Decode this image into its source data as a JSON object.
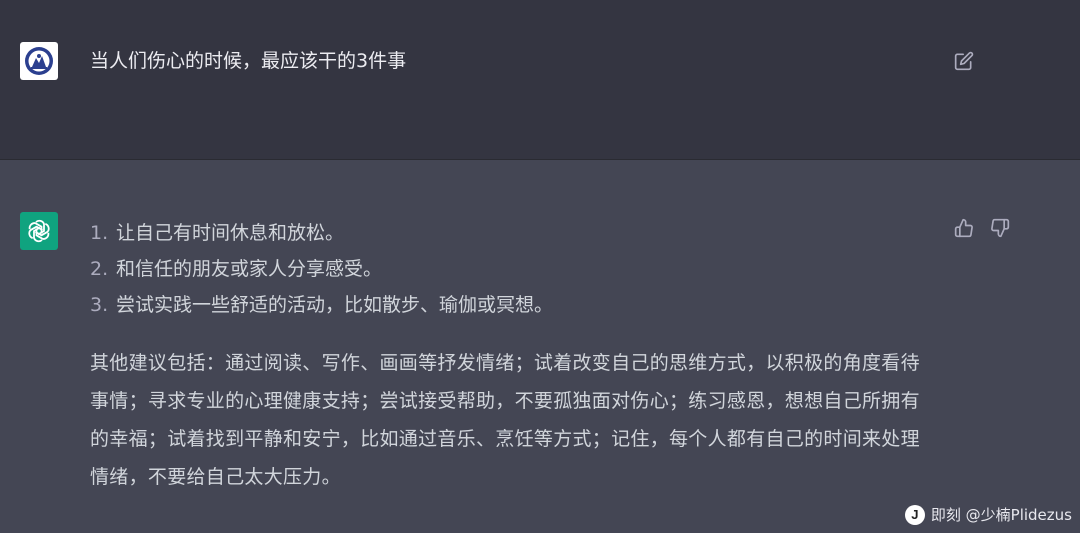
{
  "user_message": {
    "avatar_icon": "user-avatar-icon",
    "text": "当人们伤心的时候，最应该干的3件事",
    "edit_icon": "edit-icon"
  },
  "assistant_message": {
    "avatar_icon": "chatgpt-logo-icon",
    "avatar_color": "#10a37f",
    "list": [
      {
        "num": "1.",
        "text": "让自己有时间休息和放松。"
      },
      {
        "num": "2.",
        "text": "和信任的朋友或家人分享感受。"
      },
      {
        "num": "3.",
        "text": "尝试实践一些舒适的活动，比如散步、瑜伽或冥想。"
      }
    ],
    "paragraph": "其他建议包括：通过阅读、写作、画画等抒发情绪；试着改变自己的思维方式，以积极的角度看待事情；寻求专业的心理健康支持；尝试接受帮助，不要孤独面对伤心；练习感恩，想想自己所拥有的幸福；试着找到平静和安宁，比如通过音乐、烹饪等方式；记住，每个人都有自己的时间来处理情绪，不要给自己太大压力。",
    "feedback": {
      "thumbs_up_icon": "thumbs-up-icon",
      "thumbs_down_icon": "thumbs-down-icon"
    }
  },
  "watermark": {
    "logo_letter": "J",
    "text": "即刻 @少楠Plidezus"
  },
  "colors": {
    "user_bg": "#343541",
    "assistant_bg": "#444654",
    "text": "#d1d5db"
  }
}
